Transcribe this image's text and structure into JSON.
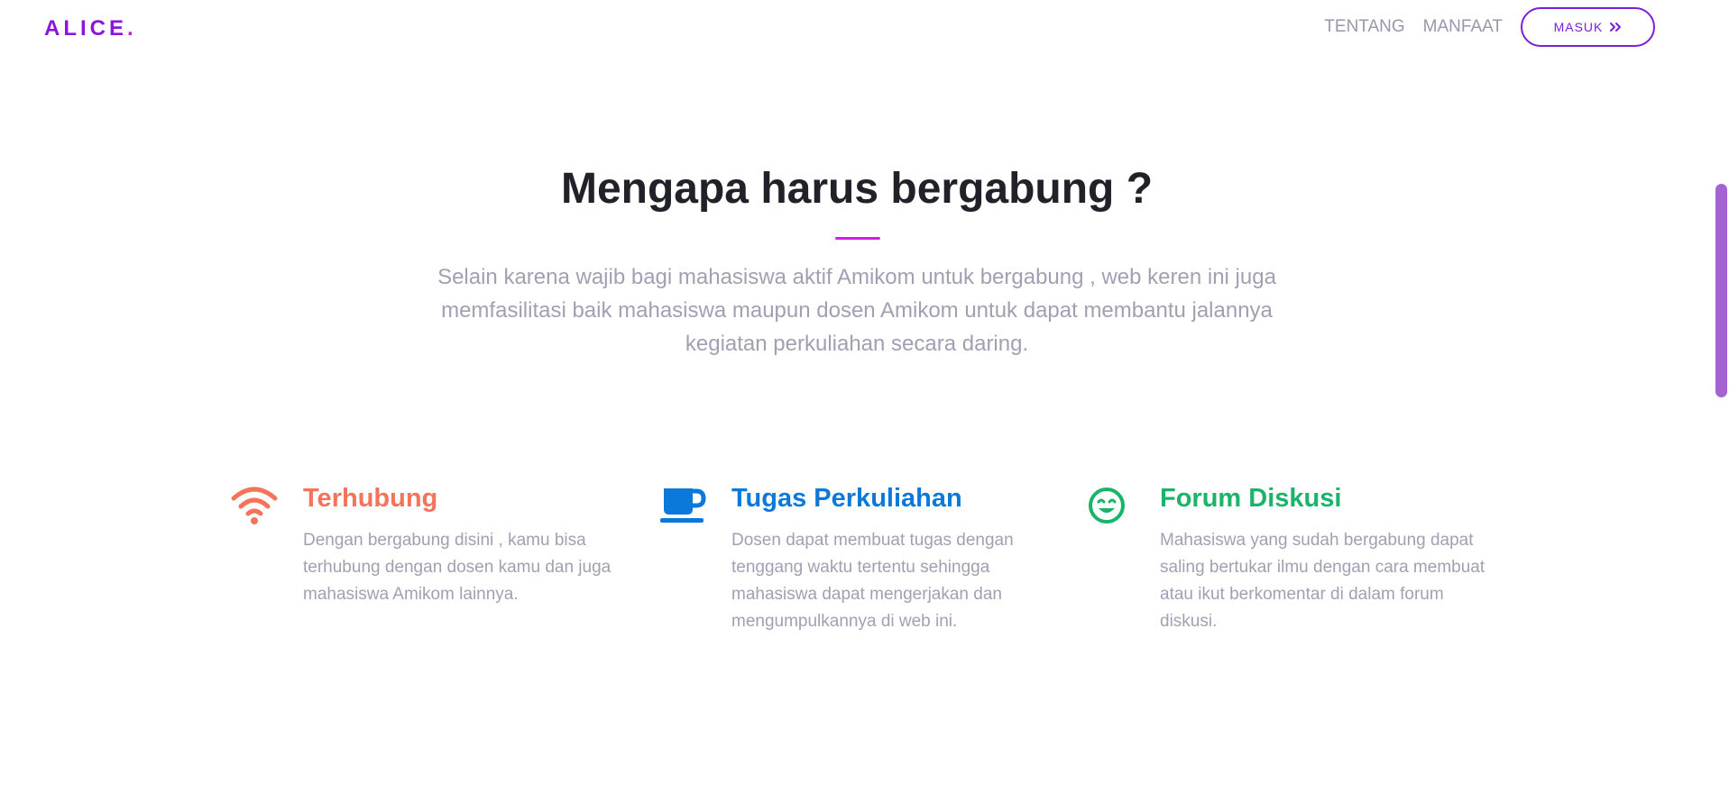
{
  "nav": {
    "brand": "ALICE",
    "brand_dot": ".",
    "links": [
      "TENTANG",
      "MANFAAT"
    ],
    "cta_label": "MASUK"
  },
  "hero": {
    "title": "Mengapa harus bergabung ?",
    "description": "Selain karena wajib bagi mahasiswa aktif Amikom untuk bergabung , web keren ini juga memfasilitasi baik mahasiswa maupun dosen Amikom untuk dapat membantu jalannya kegiatan perkuliahan secara daring."
  },
  "features": [
    {
      "icon": "wifi-icon",
      "color": "#f4735b",
      "title": "Terhubung",
      "description": "Dengan bergabung disini , kamu bisa terhubung dengan dosen kamu dan juga mahasiswa Amikom lainnya."
    },
    {
      "icon": "coffee-cup-icon",
      "color": "#0b79d9",
      "title": "Tugas Perkuliahan",
      "description": "Dosen dapat membuat tugas dengan tenggang waktu tertentu sehingga mahasiswa dapat mengerjakan dan mengumpulkannya di web ini."
    },
    {
      "icon": "smiley-icon",
      "color": "#19b46a",
      "title": "Forum Diskusi",
      "description": "Mahasiswa yang sudah bergabung dapat saling bertukar ilmu dengan cara membuat atau ikut berkomentar di dalam forum diskusi."
    }
  ],
  "colors": {
    "brand": "#8a14e0",
    "accent": "#d61ce3",
    "cta_border": "#7b1fd8",
    "muted_text": "#a39fb3",
    "scrollbar_thumb": "#a563d1"
  }
}
